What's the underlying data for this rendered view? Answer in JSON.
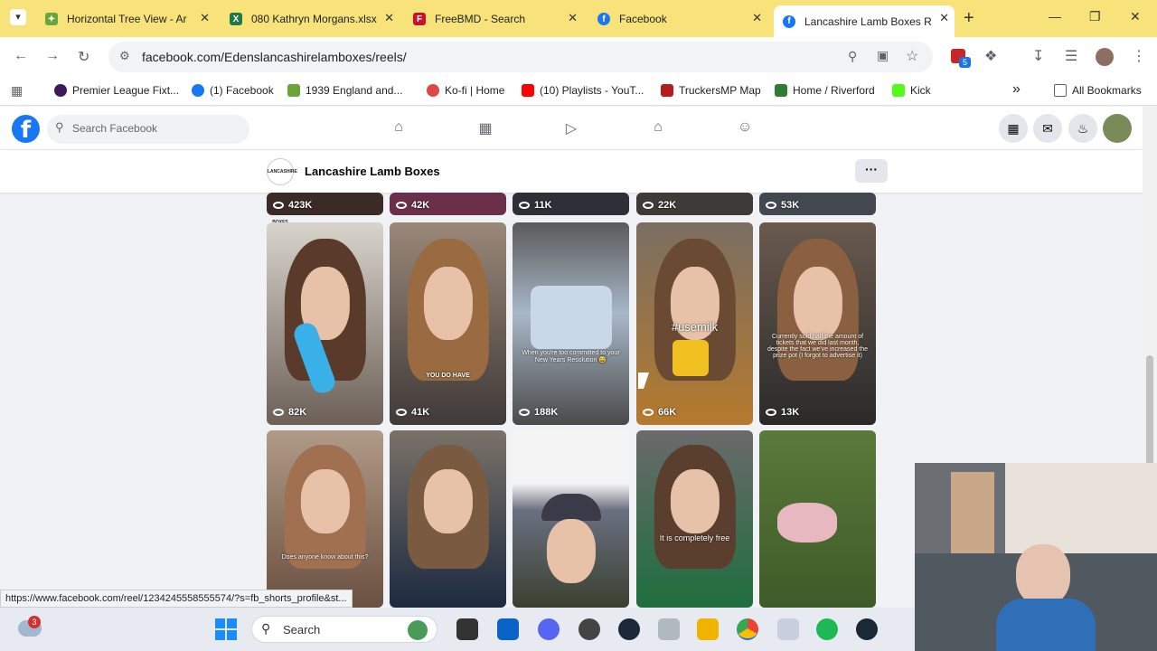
{
  "browser": {
    "tabs": [
      {
        "title": "Horizontal Tree View - Ar",
        "icon": "ancestry-icon",
        "color": "#6ba539"
      },
      {
        "title": "080 Kathryn Morgans.xlsx",
        "icon": "excel-icon",
        "color": "#1d7a45"
      },
      {
        "title": "FreeBMD - Search",
        "icon": "freebmd-icon",
        "color": "#c8102e"
      },
      {
        "title": "Facebook",
        "icon": "facebook-icon",
        "color": "#1877f2"
      },
      {
        "title": "Lancashire Lamb Boxes R",
        "icon": "facebook-icon",
        "color": "#1877f2",
        "active": true
      }
    ],
    "new_tab": "+",
    "url": "facebook.com/Edenslancashirelamboxes/reels/",
    "extension_badge": "5",
    "bookmarks": [
      {
        "label": "Premier League Fixt...",
        "color": "#3d195b"
      },
      {
        "label": "(1) Facebook",
        "color": "#1877f2"
      },
      {
        "label": "1939 England and...",
        "color": "#6ba539"
      },
      {
        "label": "Ko-fi | Home",
        "color": "#e04646"
      },
      {
        "label": "(10) Playlists - YouT...",
        "color": "#ff0000"
      },
      {
        "label": "TruckersMP Map",
        "color": "#b71c1c"
      },
      {
        "label": "Home / Riverford",
        "color": "#2e7d32"
      },
      {
        "label": "Kick",
        "color": "#53fc18"
      }
    ],
    "more_bookmarks": "»",
    "all_bookmarks": "All Bookmarks"
  },
  "facebook": {
    "search_placeholder": "Search Facebook",
    "page_name": "Lancashire Lamb Boxes",
    "page_logo_text": "LANCASHIRE LAMB BOXES",
    "more_label": "···"
  },
  "reels": {
    "top_row_views": [
      "423K",
      "42K",
      "11K",
      "22K",
      "53K"
    ],
    "row2": [
      {
        "views": "82K",
        "caption": ""
      },
      {
        "views": "41K",
        "caption": "YOU DO HAVE"
      },
      {
        "views": "188K",
        "caption": "When you're too committed to your New Years Resolution 😅"
      },
      {
        "views": "66K",
        "caption": "#usemilk"
      },
      {
        "views": "13K",
        "caption": "Currently sold half the amount of tickets that we did last month, despite the fact we've increased the prize pot (I forgot to advertise it)"
      }
    ],
    "row3": [
      {
        "caption": "Does anyone know about this?"
      },
      {
        "caption": ""
      },
      {
        "caption": ""
      },
      {
        "caption": "It is completely free"
      },
      {
        "caption": ""
      }
    ]
  },
  "status_url": "https://www.facebook.com/reel/1234245558555574/?s=fb_shorts_profile&st...",
  "taskbar": {
    "search_label": "Search",
    "weather_badge": "3"
  },
  "colors": {
    "tabstrip": "#f8e27a",
    "facebook_blue": "#1877f2"
  }
}
